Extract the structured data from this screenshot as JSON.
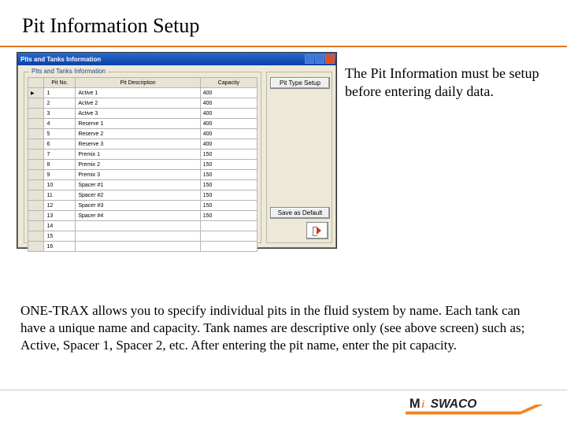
{
  "slide": {
    "title": "Pit Information Setup",
    "callout": "The Pit Information must be setup before entering daily data.",
    "bodytext": "ONE-TRAX allows you to specify individual pits in the fluid system by name. Each tank can have a unique name and capacity. Tank names are descriptive only (see above screen) such as; Active, Spacer 1, Spacer 2, etc. After entering the pit name, enter the pit capacity."
  },
  "window": {
    "title": "Pits and Tanks Information",
    "grouptitle": "Pits and Tanks Information",
    "buttons": {
      "pit_type": "Pit Type Setup",
      "save_default": "Save as Default"
    },
    "table": {
      "headers": {
        "pitno": "Pit No.",
        "desc": "Pit Description",
        "cap": "Capacity"
      },
      "rows": [
        {
          "no": "1",
          "desc": "Active 1",
          "cap": "400"
        },
        {
          "no": "2",
          "desc": "Active 2",
          "cap": "400"
        },
        {
          "no": "3",
          "desc": "Active 3",
          "cap": "400"
        },
        {
          "no": "4",
          "desc": "Reserve 1",
          "cap": "400"
        },
        {
          "no": "5",
          "desc": "Reserve 2",
          "cap": "400"
        },
        {
          "no": "6",
          "desc": "Reserve 3",
          "cap": "400"
        },
        {
          "no": "7",
          "desc": "Premix 1",
          "cap": "150"
        },
        {
          "no": "8",
          "desc": "Premix 2",
          "cap": "150"
        },
        {
          "no": "9",
          "desc": "Premix 3",
          "cap": "150"
        },
        {
          "no": "10",
          "desc": "Spacer #1",
          "cap": "150"
        },
        {
          "no": "11",
          "desc": "Spacer #2",
          "cap": "150"
        },
        {
          "no": "12",
          "desc": "Spacer #3",
          "cap": "150"
        },
        {
          "no": "13",
          "desc": "Spacer #4",
          "cap": "150"
        },
        {
          "no": "14",
          "desc": "",
          "cap": ""
        },
        {
          "no": "15",
          "desc": "",
          "cap": ""
        },
        {
          "no": "16",
          "desc": "",
          "cap": ""
        }
      ]
    }
  },
  "branding": {
    "company": "Mi SWACO"
  }
}
